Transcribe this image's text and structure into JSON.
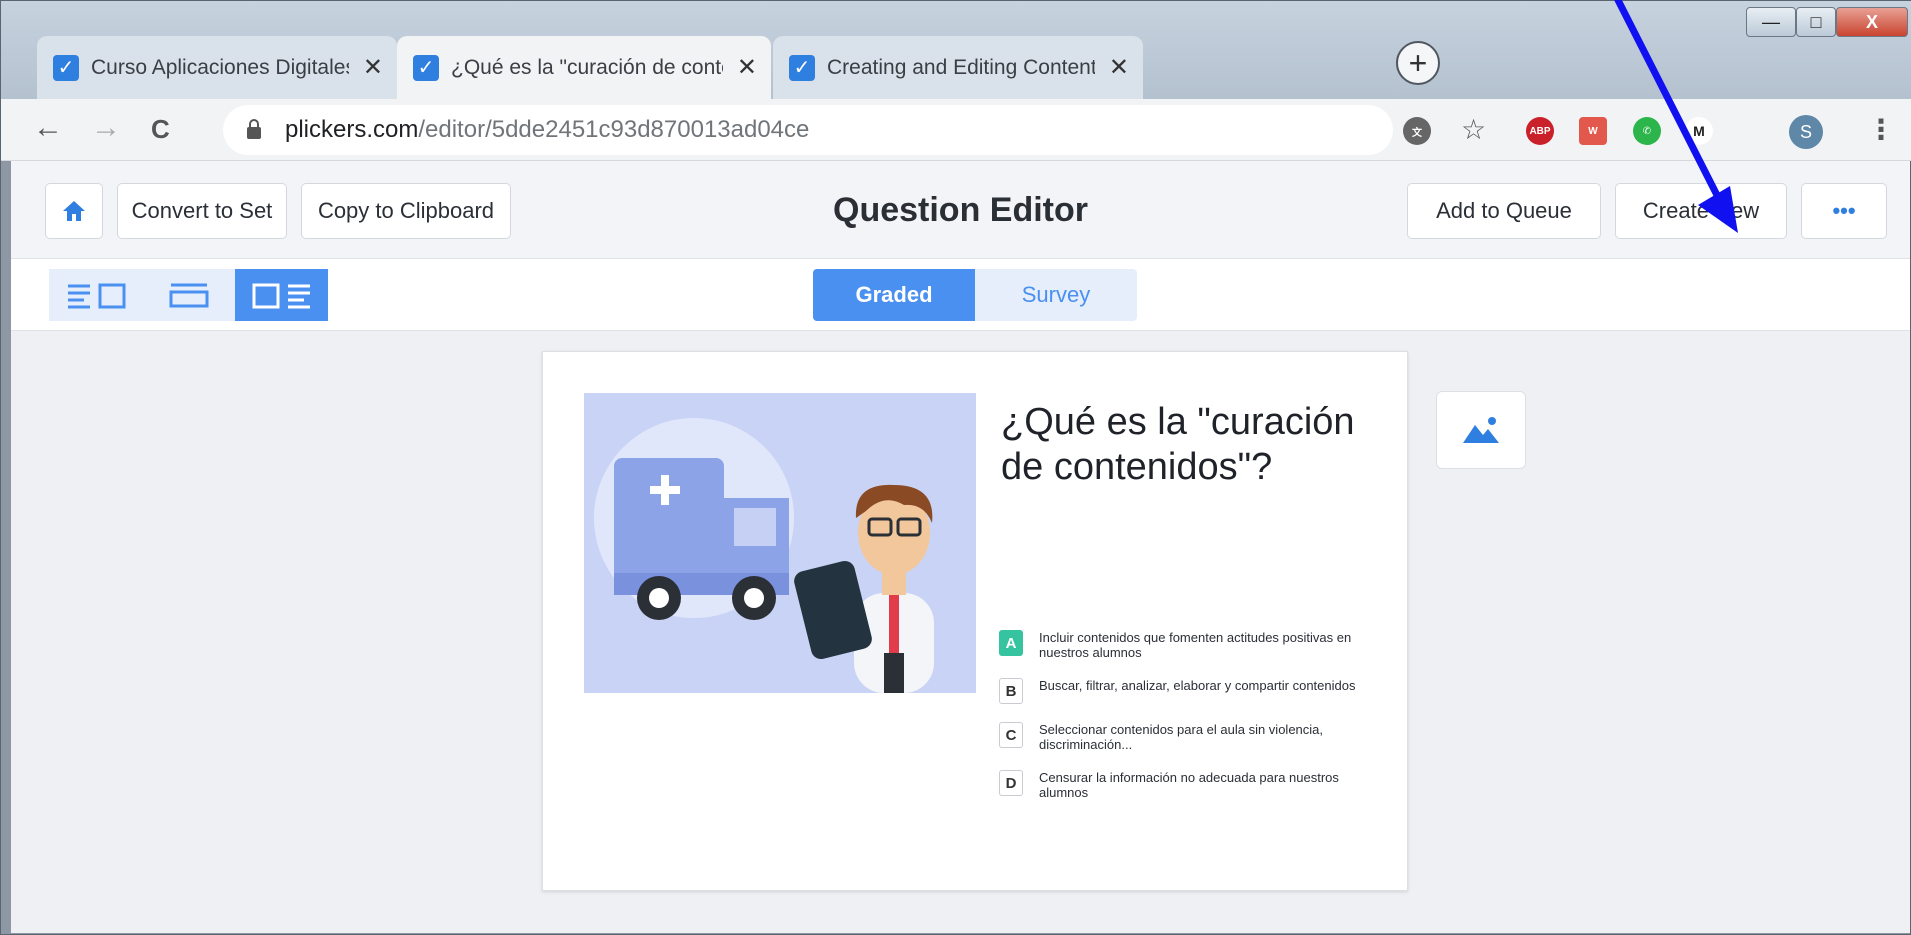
{
  "browser": {
    "tabs": [
      {
        "title": "Curso Aplicaciones Digitales - Pli",
        "close": "✕"
      },
      {
        "title": "¿Qué es la \"curación de contenid",
        "close": "✕"
      },
      {
        "title": "Creating and Editing Content – P",
        "close": "✕"
      }
    ],
    "new_tab": "+",
    "window_controls": {
      "minimize": "—",
      "maximize": "□",
      "close": "X"
    },
    "nav": {
      "back": "←",
      "forward": "→",
      "reload": "C"
    },
    "url_host": "plickers.com",
    "url_path": "/editor/5dde2451c93d870013ad04ce",
    "extensions": [
      "ABP",
      "W",
      "M"
    ],
    "avatar_initial": "S",
    "star": "☆",
    "menu": "⋮"
  },
  "toolbar": {
    "home_icon": "home-icon",
    "convert_label": "Convert to Set",
    "copy_label": "Copy to Clipboard",
    "title": "Question Editor",
    "add_queue_label": "Add to Queue",
    "create_new_label": "Create New",
    "more_label": "•••"
  },
  "subbar": {
    "graded_label": "Graded",
    "survey_label": "Survey",
    "selected_layout": 3
  },
  "question": {
    "text": "¿Qué es la \"curación de contenidos\"?",
    "answers": [
      {
        "letter": "A",
        "text": "Incluir contenidos que fomenten actitudes positivas en nuestros alumnos",
        "correct": true
      },
      {
        "letter": "B",
        "text": "Buscar, filtrar, analizar, elaborar y compartir contenidos",
        "correct": false
      },
      {
        "letter": "C",
        "text": "Seleccionar contenidos para el aula sin violencia, discriminación...",
        "correct": false
      },
      {
        "letter": "D",
        "text": "Censurar la información no adecuada para nuestros alumnos",
        "correct": false
      }
    ]
  },
  "colors": {
    "accent": "#4a90f0",
    "correct": "#35c3a0",
    "annotation_arrow": "#1010f0"
  }
}
